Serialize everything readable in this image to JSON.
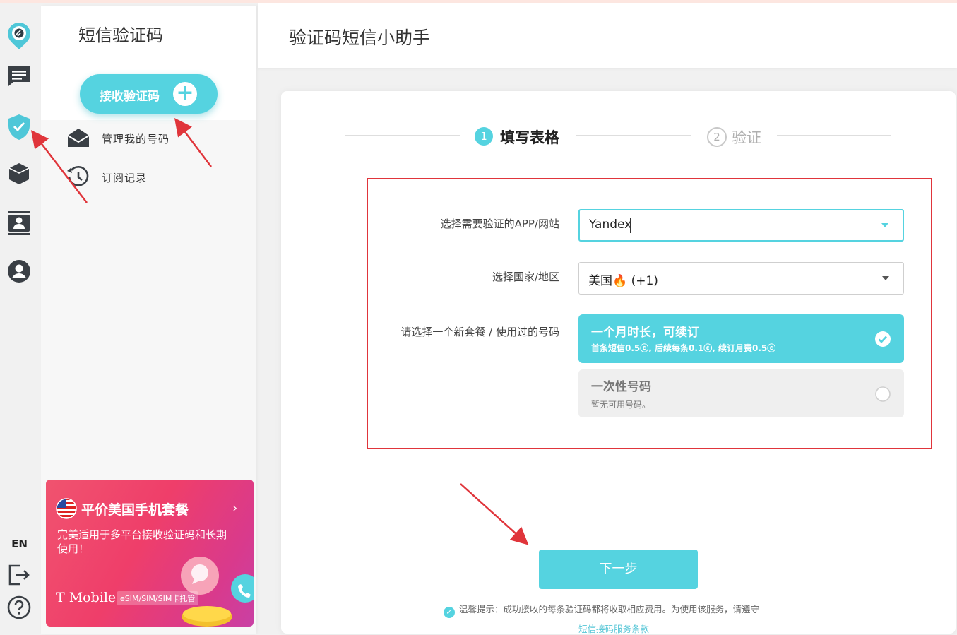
{
  "rail": {
    "lang": "EN"
  },
  "sidebar": {
    "title": "短信验证码",
    "receive_button": "接收验证码",
    "items": [
      {
        "label": "管理我的号码"
      },
      {
        "label": "订阅记录"
      }
    ],
    "promo": {
      "title": "平价美国手机套餐",
      "desc": "完美适用于多平台接收验证码和长期使用！",
      "brand": "T Mobile",
      "tag": "eSIM/SIM/SIM卡托管"
    }
  },
  "header": {
    "title": "验证码短信小助手"
  },
  "steps": [
    {
      "num": "1",
      "label": "填写表格"
    },
    {
      "num": "2",
      "label": "验证"
    }
  ],
  "form": {
    "app_label": "选择需要验证的APP/网站",
    "app_value": "Yandex",
    "country_label": "选择国家/地区",
    "country_value": "美国🔥 (+1)",
    "plan_label": "请选择一个新套餐 / 使用过的号码",
    "plans": [
      {
        "title": "一个月时长，可续订",
        "sub": "首条短信0.5ⓒ, 后续每条0.1ⓒ, 续订月费0.5ⓒ",
        "selected": true
      },
      {
        "title": "一次性号码",
        "sub": "暂无可用号码。",
        "selected": false
      }
    ]
  },
  "next_button": "下一步",
  "tip": "温馨提示：成功接收的每条验证码都将收取相应费用。为使用该服务，请遵守",
  "terms_link": "短信接码服务条款",
  "colors": {
    "accent": "#55d3e0",
    "annotation_red": "#e0353b"
  }
}
